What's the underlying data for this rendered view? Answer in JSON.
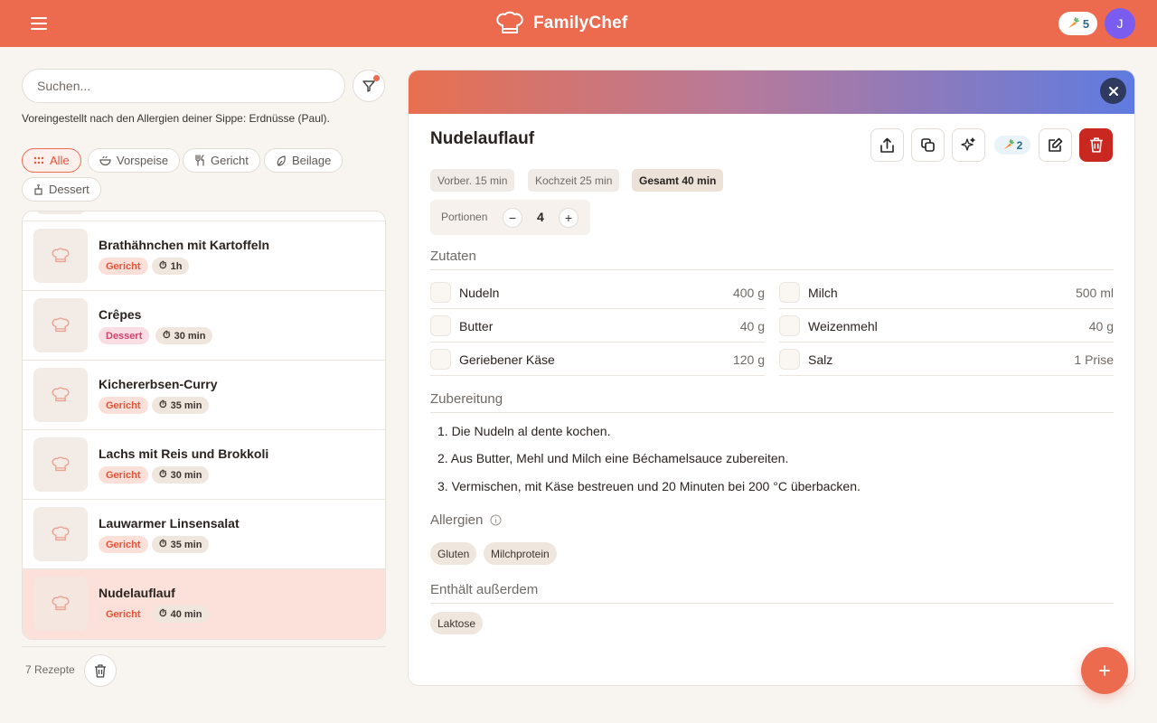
{
  "app": {
    "name": "FamilyChef"
  },
  "header": {
    "carrot_count": "5",
    "avatar_initial": "J"
  },
  "sidebar": {
    "search_placeholder": "Suchen...",
    "allergy_note": "Voreingestellt nach den Allergien deiner Sippe: Erdnüsse (Paul).",
    "filters": [
      "Alle",
      "Vorspeise",
      "Gericht",
      "Beilage",
      "Dessert"
    ],
    "active_filter": "Alle",
    "recipes": [
      {
        "title": "Brathähnchen mit Kartoffeln",
        "category": "Gericht",
        "time": "1h"
      },
      {
        "title": "Crêpes",
        "category": "Dessert",
        "time": "30 min"
      },
      {
        "title": "Kichererbsen-Curry",
        "category": "Gericht",
        "time": "35 min"
      },
      {
        "title": "Lachs mit Reis und Brokkoli",
        "category": "Gericht",
        "time": "30 min"
      },
      {
        "title": "Lauwarmer Linsensalat",
        "category": "Gericht",
        "time": "35 min"
      },
      {
        "title": "Nudelauflauf",
        "category": "Gericht",
        "time": "40 min"
      }
    ],
    "selected_recipe": "Nudelauflauf",
    "count_label": "7 Rezepte"
  },
  "detail": {
    "title": "Nudelauflauf",
    "carrot_count": "2",
    "times": {
      "prep": "Vorber. 15 min",
      "cook": "Kochzeit 25 min",
      "total": "Gesamt 40 min"
    },
    "portions_label": "Portionen",
    "portions": "4",
    "ingredients_heading": "Zutaten",
    "ingredients": [
      {
        "name": "Nudeln",
        "qty": "400 g"
      },
      {
        "name": "Milch",
        "qty": "500 ml"
      },
      {
        "name": "Butter",
        "qty": "40 g"
      },
      {
        "name": "Weizenmehl",
        "qty": "40 g"
      },
      {
        "name": "Geriebener Käse",
        "qty": "120 g"
      },
      {
        "name": "Salz",
        "qty": "1 Prise"
      }
    ],
    "steps_heading": "Zubereitung",
    "steps": [
      "1. Die Nudeln al dente kochen.",
      "2. Aus Butter, Mehl und Milch eine Béchamelsauce zubereiten.",
      "3. Vermischen, mit Käse bestreuen und 20 Minuten bei 200 °C überbacken."
    ],
    "allergens_heading": "Allergien",
    "allergens": [
      "Gluten",
      "Milchprotein"
    ],
    "also_contains_heading": "Enthält außerdem",
    "also_contains": [
      "Laktose"
    ]
  },
  "colors": {
    "primary": "#ec6b4f",
    "avatar": "#7b5cf0",
    "danger": "#c82820",
    "selected_row": "#fbe1d9"
  },
  "icons": [
    "menu-icon",
    "chef-hat-icon",
    "carrot-icon",
    "filter-icon",
    "grid-icon",
    "bowl-icon",
    "cutlery-icon",
    "leaf-icon",
    "dessert-icon",
    "timer-icon",
    "trash-icon",
    "close-icon",
    "share-icon",
    "copy-icon",
    "sparkle-icon",
    "edit-icon",
    "info-icon",
    "plus-icon"
  ]
}
